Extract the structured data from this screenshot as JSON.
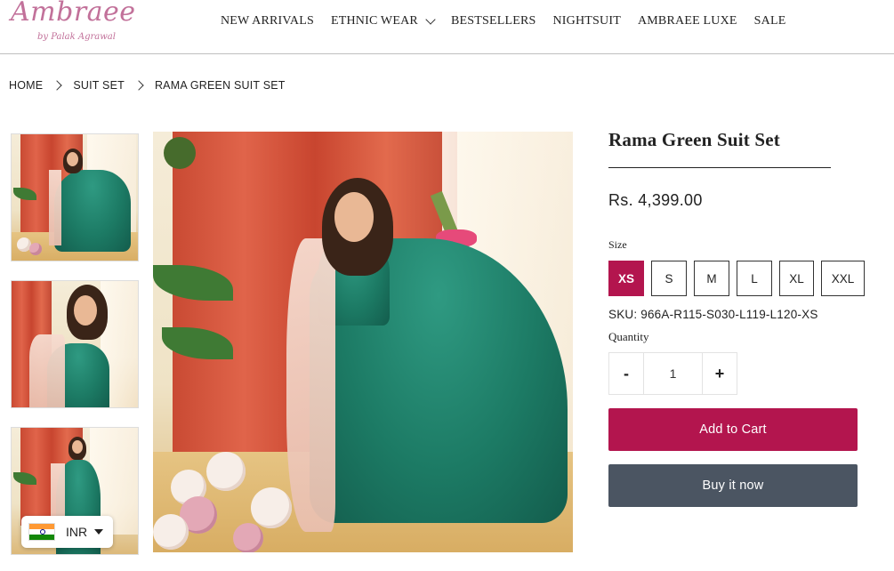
{
  "brand": {
    "name": "Ambraee",
    "tagline": "by Palak Agrawal"
  },
  "nav": {
    "items": [
      {
        "label": "NEW ARRIVALS"
      },
      {
        "label": "ETHNIC WEAR",
        "has_dropdown": true
      },
      {
        "label": "BESTSELLERS"
      },
      {
        "label": "NIGHTSUIT"
      },
      {
        "label": "AMBRAEE LUXE"
      },
      {
        "label": "SALE"
      }
    ]
  },
  "breadcrumb": [
    "HOME",
    "SUIT SET",
    "RAMA GREEN SUIT SET"
  ],
  "product": {
    "title": "Rama Green Suit Set",
    "price": "Rs. 4,399.00",
    "size_label": "Size",
    "sizes": [
      "XS",
      "S",
      "M",
      "L",
      "XL",
      "XXL"
    ],
    "selected_size": "XS",
    "sku": "SKU: 966A-R115-S030-L119-L120-XS",
    "quantity_label": "Quantity",
    "quantity": "1",
    "qty_minus": "-",
    "qty_plus": "+",
    "add_to_cart": "Add to Cart",
    "buy_now": "Buy it now"
  },
  "currency": {
    "code": "INR",
    "flag": "india-flag-icon"
  },
  "colors": {
    "accent": "#b3154e",
    "buy_now_bg": "#4b5562",
    "logo": "#c2719a",
    "dress": "#1c7a64"
  }
}
